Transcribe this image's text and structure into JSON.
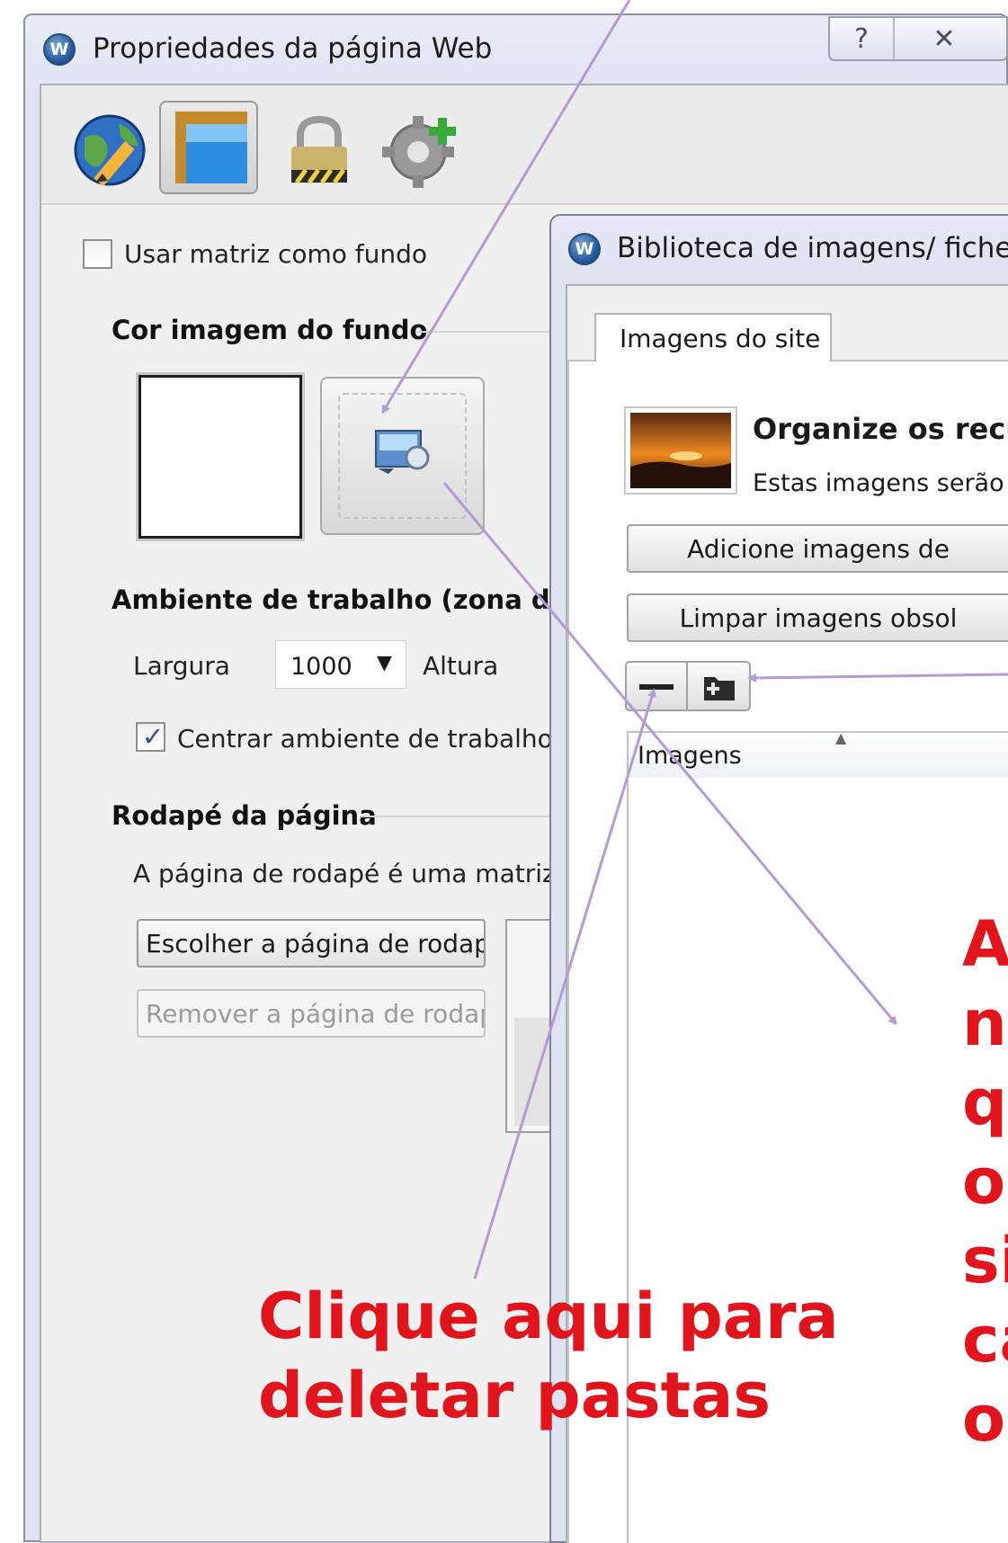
{
  "main_dialog": {
    "title": "Propriedades da página Web",
    "logo_letter": "W",
    "help_glyph": "?",
    "close_glyph": "✕",
    "toolbar_icons": [
      "globe-edit-icon",
      "layout-icon",
      "lock-icon",
      "gear-add-icon"
    ],
    "use_template_bg_label": "Usar matriz como fundo",
    "bg_section_title": "Cor  imagem do fundo",
    "workspace_section_title": "Ambiente de trabalho (zona de c",
    "width_label": "Largura",
    "width_value": "1000",
    "height_label": "Altura",
    "center_workspace_label": "Centrar ambiente de trabalho na",
    "footer_section_title": "Rodapé da página",
    "footer_description": "A página de rodapé é uma matriz sit",
    "choose_footer_button": "Escolher a página de rodapé",
    "remove_footer_button": "Remover a página de rodapé"
  },
  "library_dialog": {
    "title": "Biblioteca de imagens/ ficheiro",
    "logo_letter": "W",
    "tab_label": "Imagens do site",
    "heading": "Organize os recu",
    "subtext": "Estas imagens serão a",
    "add_images_button": "Adicione imagens de",
    "clean_images_button": "Limpar imagens obsol",
    "list_column_header": "Imagens"
  },
  "annotations": {
    "delete_folder_note": [
      "Clique aqui para",
      "deletar pastas"
    ],
    "side_note_letters": [
      "A",
      "n",
      "q",
      "o",
      "si",
      "ca",
      "o"
    ]
  },
  "colors": {
    "annotation_red": "#e2141b",
    "arrow_purple": "#b49ad6",
    "window_frame": "#dfe4f2",
    "panel_bg": "#f0f0f0"
  }
}
